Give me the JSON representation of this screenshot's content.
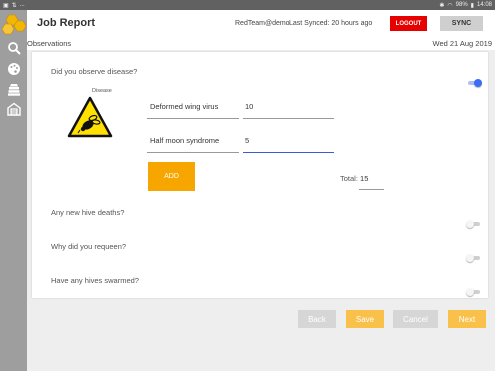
{
  "status_bar": {
    "left_icons": [
      "image-icon",
      "signal-icon",
      "wifi-icon"
    ],
    "ellipsis": "...",
    "battery": "98%",
    "time": "14:08"
  },
  "header": {
    "title": "Job Report",
    "user": "RedTeam@demo",
    "last_synced": "Last Synced:  20 hours ago",
    "logout_label": "LOGOUT",
    "sync_label": "SYNC"
  },
  "subheader": {
    "section": "Observations",
    "date": "Wed 21 Aug 2019"
  },
  "sidebar": {
    "items": [
      "search-icon",
      "palette-icon",
      "hive-icon",
      "building-icon"
    ]
  },
  "questions": {
    "disease": {
      "label": "Did you observe disease?",
      "on": true
    },
    "hive_deaths": {
      "label": "Any new hive deaths?",
      "on": false
    },
    "requeen": {
      "label": "Why did you requeen?",
      "on": false
    },
    "swarmed": {
      "label": "Have any hives swarmed?",
      "on": false
    }
  },
  "disease_panel": {
    "caption": "Disease",
    "rows": [
      {
        "name": "Deformed wing virus",
        "count": "10"
      },
      {
        "name": "Half moon syndrome",
        "count": "5"
      }
    ],
    "add_label": "ADD",
    "total_label": "Total:",
    "total_value": "15"
  },
  "footer": {
    "back": "Back",
    "save": "Save",
    "cancel": "Cancel",
    "next": "Next"
  },
  "colors": {
    "accent": "#f7a600",
    "toggle_on": "#3b6ef5",
    "logout": "#e60000",
    "disabled_button": "#d6d6d6",
    "active_underline": "#3b5bdb"
  }
}
